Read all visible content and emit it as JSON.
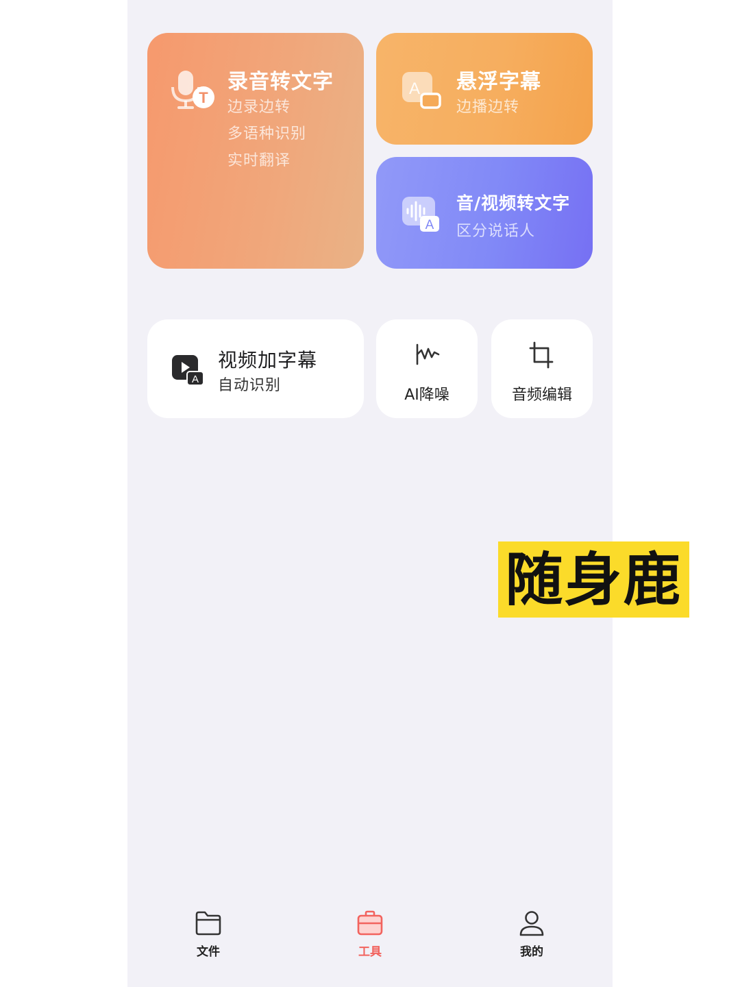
{
  "tools": {
    "record": {
      "title": "录音转文字",
      "lines": [
        "边录边转",
        "多语种识别",
        "实时翻译"
      ],
      "icon": "mic-text-icon"
    },
    "float_caption": {
      "title": "悬浮字幕",
      "subtitle": "边播边转",
      "icon": "caption-icon"
    },
    "av_to_text": {
      "title": "音/视频转文字",
      "subtitle": "区分说话人",
      "icon": "waveform-text-icon"
    },
    "video_subtitle": {
      "title": "视频加字幕",
      "subtitle": "自动识别",
      "icon": "video-subtitle-icon"
    },
    "ai_denoise": {
      "label": "AI降噪",
      "icon": "waveform-icon"
    },
    "audio_edit": {
      "label": "音频编辑",
      "icon": "crop-icon"
    }
  },
  "tabbar": {
    "items": [
      {
        "label": "文件",
        "icon": "folder-icon"
      },
      {
        "label": "工具",
        "icon": "toolbox-icon",
        "active": true
      },
      {
        "label": "我的",
        "icon": "user-icon"
      }
    ]
  },
  "overlay": {
    "text": "随身鹿"
  },
  "colors": {
    "accent": "#f2635e",
    "orange": "#f6996d",
    "amber": "#f6ae5f",
    "purple": "#8189f7",
    "brand_yellow": "#fbdb2a"
  }
}
